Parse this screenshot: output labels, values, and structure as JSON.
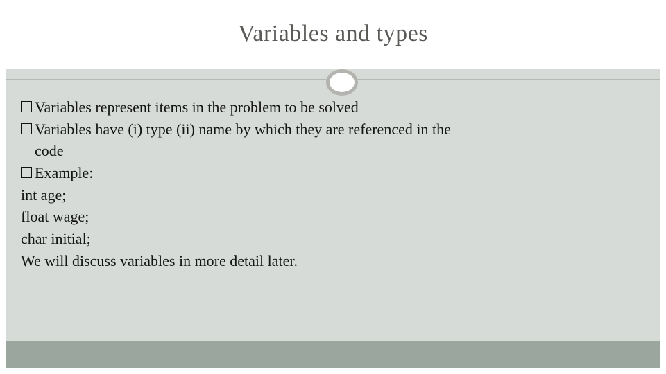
{
  "title": "Variables and types",
  "bullets": [
    "Variables represent items in the problem to be solved",
    "Variables have (i) type (ii) name by which they are referenced in the",
    "Example:"
  ],
  "bullets_cont": [
    "code"
  ],
  "lines": [
    "int age;",
    "float wage;",
    "char initial;",
    "We will discuss variables in more detail later."
  ]
}
